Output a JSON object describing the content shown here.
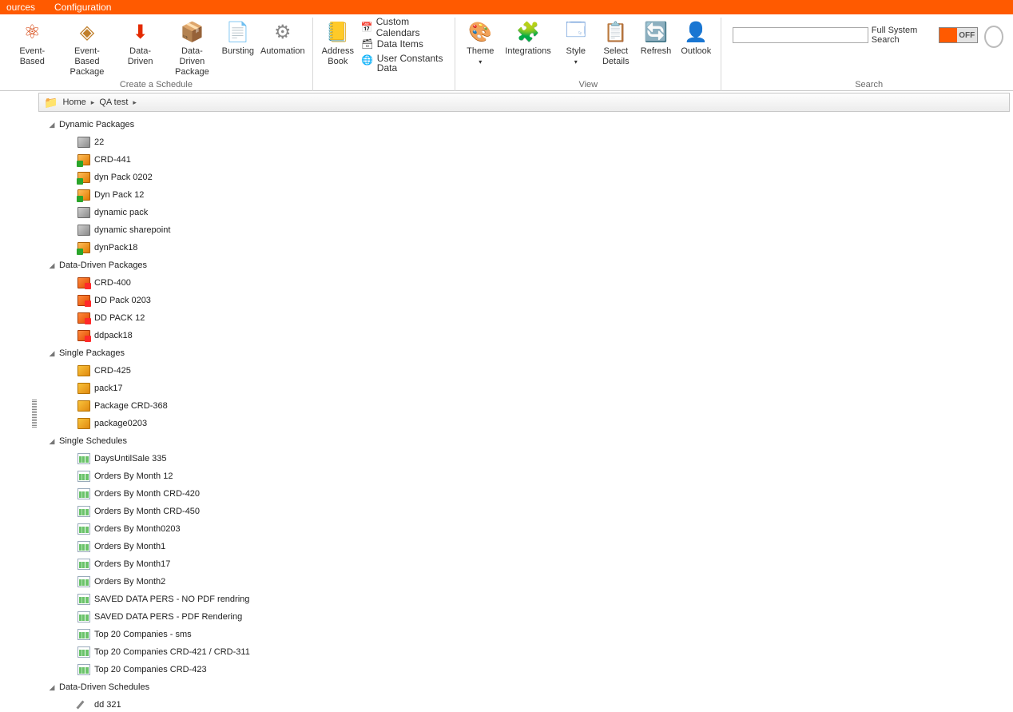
{
  "menubar": {
    "resources": "ources",
    "configuration": "Configuration"
  },
  "ribbon": {
    "group_create": "Create a Schedule",
    "group_view": "View",
    "group_search": "Search",
    "event_based": "Event-Based",
    "event_based_package": "Event-Based\nPackage",
    "data_driven": "Data-Driven",
    "data_driven_package": "Data-Driven\nPackage",
    "bursting": "Bursting",
    "automation": "Automation",
    "address_book": "Address\nBook",
    "custom_calendars": "Custom Calendars",
    "data_items": "Data Items",
    "user_constants": "User Constants\nData",
    "theme": "Theme",
    "integrations": "Integrations",
    "style": "Style",
    "select_details": "Select\nDetails",
    "refresh": "Refresh",
    "outlook": "Outlook",
    "search_label": "Full System Search",
    "toggle_off": "OFF"
  },
  "breadcrumb": {
    "home": "Home",
    "qatest": "QA test"
  },
  "tree": {
    "g1": "Dynamic Packages",
    "g1_items": [
      "22",
      "CRD-441",
      "dyn Pack 0202",
      "Dyn Pack 12",
      "dynamic pack",
      "dynamic sharepoint",
      "dynPack18"
    ],
    "g1_icons": [
      "grey",
      "dyn",
      "dyn",
      "dyn",
      "grey",
      "grey",
      "dyn"
    ],
    "g2": "Data-Driven Packages",
    "g2_items": [
      "CRD-400",
      "DD Pack 0203",
      "DD PACK 12",
      "ddpack18"
    ],
    "g3": "Single Packages",
    "g3_items": [
      "CRD-425",
      "pack17",
      "Package CRD-368",
      "package0203"
    ],
    "g4": "Single Schedules",
    "g4_items": [
      "DaysUntilSale 335",
      "Orders By Month 12",
      "Orders By Month CRD-420",
      "Orders By Month CRD-450",
      "Orders By Month0203",
      "Orders By Month1",
      "Orders By Month17",
      "Orders By Month2",
      "SAVED DATA PERS - NO PDF rendring",
      "SAVED DATA PERS - PDF Rendering",
      "Top 20 Companies - sms",
      "Top 20 Companies CRD-421 / CRD-311",
      "Top 20 Companies CRD-423"
    ],
    "g5": "Data-Driven Schedules",
    "g5_items": [
      "dd 321"
    ]
  }
}
